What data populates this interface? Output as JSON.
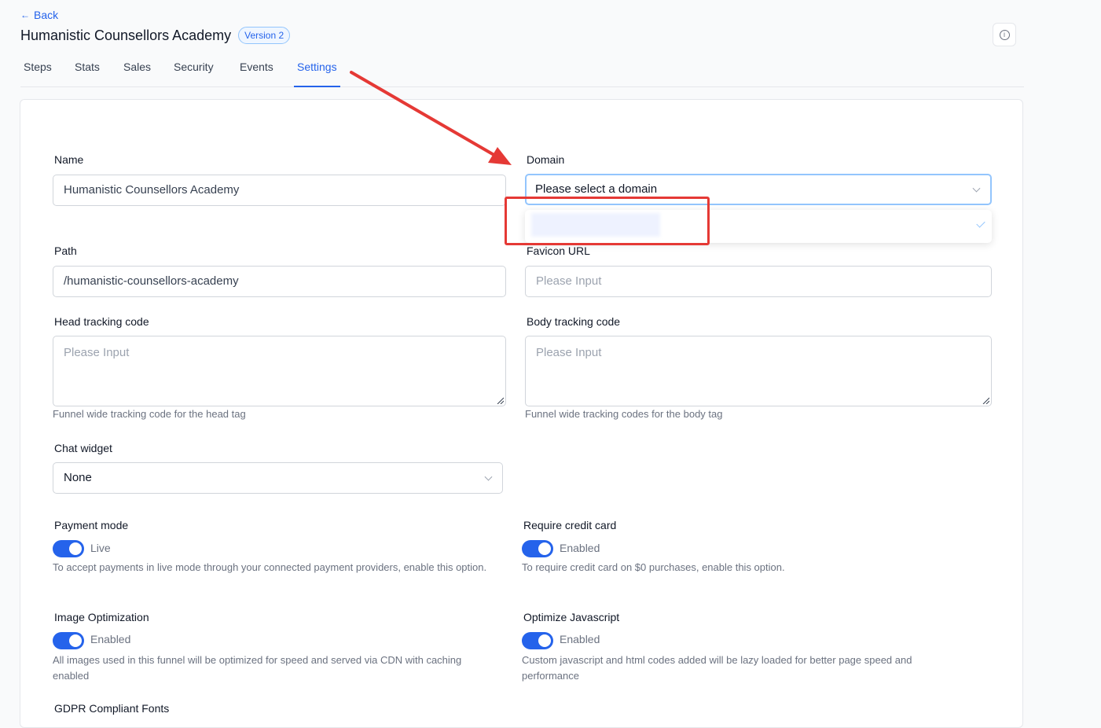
{
  "header": {
    "back_label": "Back",
    "title": "Humanistic Counsellors Academy",
    "version_badge": "Version 2",
    "info_icon": "info-icon"
  },
  "tabs": [
    {
      "label": "Steps",
      "active": false
    },
    {
      "label": "Stats",
      "active": false
    },
    {
      "label": "Sales",
      "active": false
    },
    {
      "label": "Security",
      "active": false
    },
    {
      "label": "Events",
      "active": false
    },
    {
      "label": "Settings",
      "active": true
    }
  ],
  "form": {
    "name": {
      "label": "Name",
      "value": "Humanistic Counsellors Academy"
    },
    "domain": {
      "label": "Domain",
      "value": "Please select a domain"
    },
    "path": {
      "label": "Path",
      "value": "/humanistic-counsellors-academy"
    },
    "favicon": {
      "label": "Favicon URL",
      "placeholder": "Please Input"
    },
    "head_tracking": {
      "label": "Head tracking code",
      "placeholder": "Please Input",
      "hint": "Funnel wide tracking code for the head tag"
    },
    "body_tracking": {
      "label": "Body tracking code",
      "placeholder": "Please Input",
      "hint": "Funnel wide tracking codes for the body tag"
    },
    "chat_widget": {
      "label": "Chat widget",
      "value": "None"
    },
    "payment_mode": {
      "label": "Payment mode",
      "state": "Live",
      "on": true,
      "hint": "To accept payments in live mode through your connected payment providers, enable this option."
    },
    "require_credit_card": {
      "label": "Require credit card",
      "state": "Enabled",
      "on": true,
      "hint": "To require credit card on $0 purchases, enable this option."
    },
    "image_optimization": {
      "label": "Image Optimization",
      "state": "Enabled",
      "on": true,
      "hint": "All images used in this funnel will be optimized for speed and served via CDN with caching enabled"
    },
    "optimize_js": {
      "label": "Optimize Javascript",
      "state": "Enabled",
      "on": true,
      "hint": "Custom javascript and html codes added will be lazy loaded for better page speed and performance"
    },
    "gdpr_fonts": {
      "label": "GDPR Compliant Fonts"
    }
  },
  "colors": {
    "accent": "#2563eb",
    "annotation": "#e53935"
  }
}
